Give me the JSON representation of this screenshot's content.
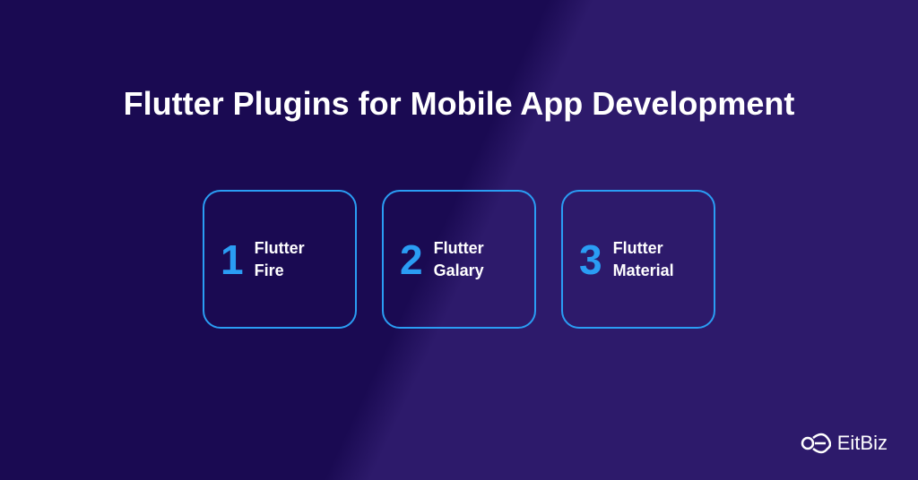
{
  "title": "Flutter Plugins for Mobile App Development",
  "cards": [
    {
      "number": "1",
      "line1": "Flutter",
      "line2": "Fire"
    },
    {
      "number": "2",
      "line1": "Flutter",
      "line2": "Galary"
    },
    {
      "number": "3",
      "line1": "Flutter",
      "line2": "Material"
    }
  ],
  "logo": {
    "text": "EitBiz"
  }
}
